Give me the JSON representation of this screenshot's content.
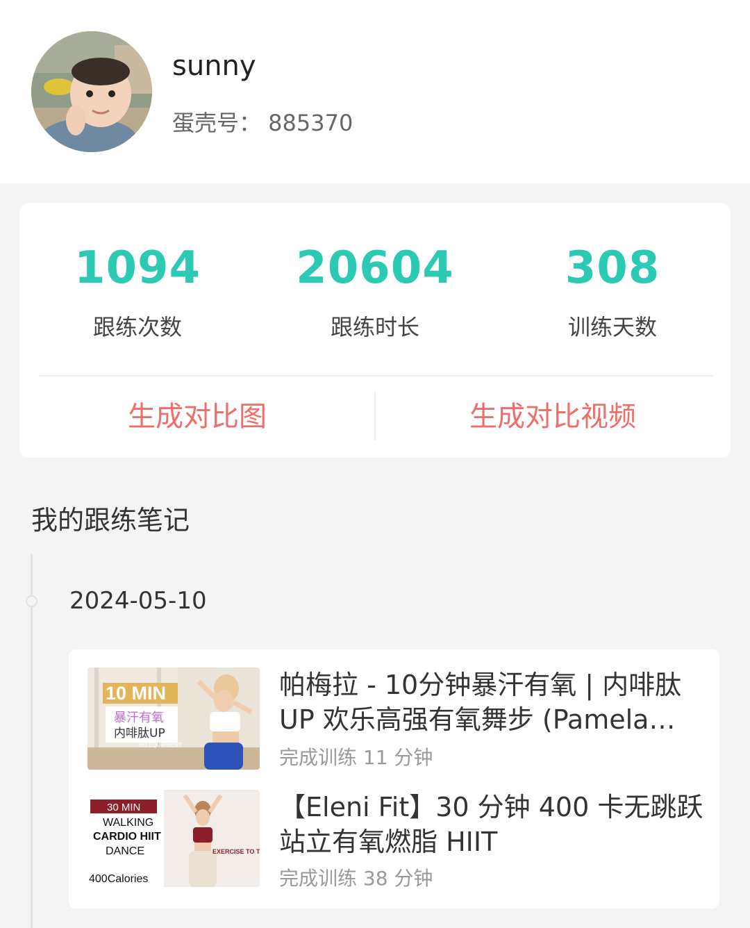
{
  "profile": {
    "username": "sunny",
    "shell_id": "蛋壳号：  885370"
  },
  "stats": [
    {
      "value": "1094",
      "label": "跟练次数"
    },
    {
      "value": "20604",
      "label": "跟练时长"
    },
    {
      "value": "308",
      "label": "训练天数"
    }
  ],
  "actions": {
    "compare_image": "生成对比图",
    "compare_video": "生成对比视频"
  },
  "notes": {
    "title": "我的跟练笔记",
    "date": "2024-05-10",
    "entries": [
      {
        "title": "帕梅拉 - 10分钟暴汗有氧 | 内啡肽UP 欢乐高强有氧舞步 (Pamela Reif)",
        "meta": "完成训练 11 分钟",
        "thumb": {
          "badge": "10 MIN",
          "line1": "暴汗有氧",
          "line2": "内啡肽UP",
          "tag": "NO EQUIPMENT"
        }
      },
      {
        "title": "【Eleni Fit】30 分钟 400 卡无跳跃站立有氧燃脂 HIIT",
        "meta": "完成训练 38 分钟",
        "thumb": {
          "badge": "30 MIN",
          "line1": "WALKING",
          "line2": "CARDIO HIIT",
          "line3": "DANCE",
          "calories": "400Calories",
          "tag": "EXERCISE TO THE BEAT"
        }
      }
    ]
  },
  "colors": {
    "accent": "#2cc9b4",
    "action": "#ef6e6b",
    "background": "#f4f4f4"
  }
}
